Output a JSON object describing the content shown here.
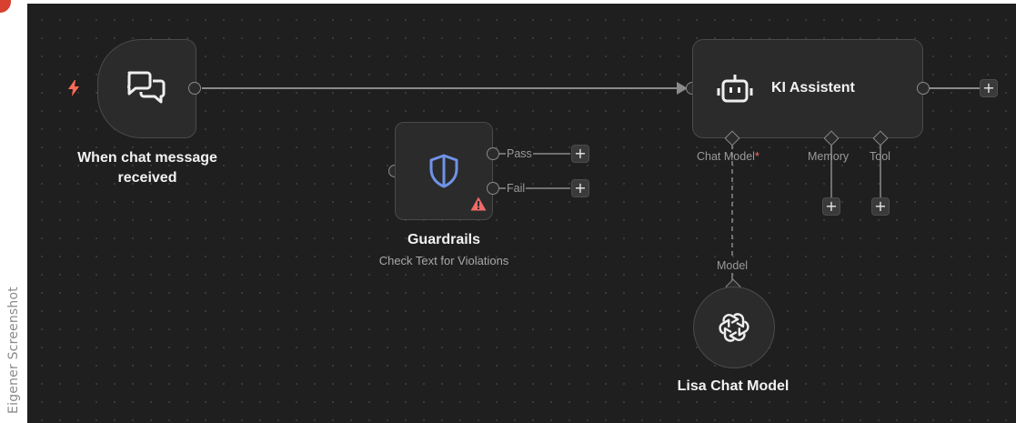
{
  "watermark": "Eigener Screenshot",
  "colors": {
    "canvas": "#1f1f1f",
    "node": "#2b2b2b",
    "accent_shield": "#6f93e8",
    "trigger_bolt": "#ff6b55",
    "warning": "#ef6a6a"
  },
  "nodes": {
    "trigger": {
      "title": "When chat message received",
      "icon": "chat-bubbles-icon",
      "badge_icon": "lightning-bolt-icon"
    },
    "guardrails": {
      "title": "Guardrails",
      "subtitle": "Check Text for Violations",
      "icon": "shield-icon",
      "warning_icon": "warning-triangle-icon",
      "outputs": [
        "Pass",
        "Fail"
      ]
    },
    "agent": {
      "title": "KI Assistent",
      "icon": "robot-icon",
      "slots": {
        "chat_model": "Chat Model",
        "chat_model_required": "*",
        "memory": "Memory",
        "tool": "Tool"
      }
    },
    "chat_model": {
      "title": "Lisa Chat Model",
      "icon": "openai-icon",
      "input_label": "Model"
    }
  },
  "add_button_label": "+"
}
